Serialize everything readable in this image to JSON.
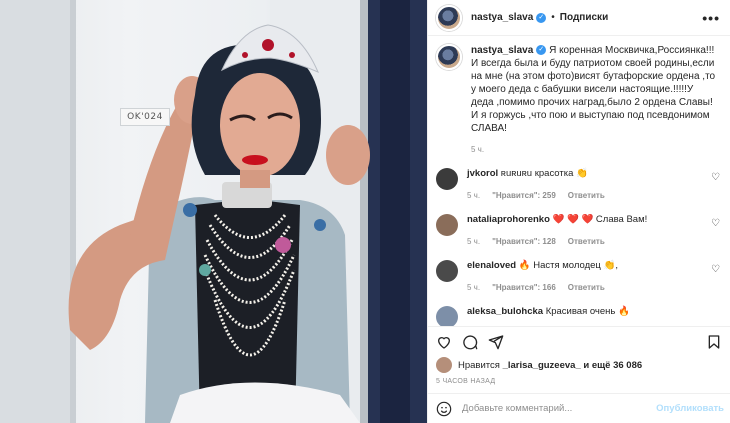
{
  "post": {
    "username": "nastya_slava",
    "follow_label": "Подписки",
    "more_label": "•••",
    "photo_tag_text": "OK'024"
  },
  "caption": {
    "username": "nastya_slava",
    "text": "Я коренная Москвичка,Россиянка!!! И всегда была и буду патриотом своей родины,если на мне (на этом фото)висят бутафорские ордена ,то у моего деда с бабушки висели настоящие.!!!!!У деда ,помимо прочих наград,было 2 ордена Славы! И я горжусь ,что пою и выступаю под псевдонимом СЛАВА!",
    "time": "5 ч."
  },
  "comments": [
    {
      "username": "jvkorol",
      "text": "ʀuʀuʀu красотка 👏",
      "time": "5 ч.",
      "likes": "\"Нравится\": 259",
      "reply": "Ответить",
      "avatar_color": "#3b3b3b"
    },
    {
      "username": "nataliaprohorenko",
      "text": "❤️ ❤️ ❤️ Слава Вам!",
      "time": "5 ч.",
      "likes": "\"Нравится\": 128",
      "reply": "Ответить",
      "avatar_color": "#8a6d5a"
    },
    {
      "username": "elenaloved",
      "text": "🔥 Настя молодец 👏,",
      "time": "5 ч.",
      "likes": "\"Нравится\": 166",
      "reply": "Ответить",
      "avatar_color": "#4a4a4a"
    },
    {
      "username": "aleksa_bulohcka",
      "text": "Красивая очень 🔥",
      "time": "",
      "likes": "",
      "reply": "",
      "avatar_color": "#7d8fa8"
    }
  ],
  "likes_line": {
    "prefix": "Нравится",
    "user": "_larisa_guzeeva_",
    "suffix": "и ещё 36 086"
  },
  "posted_ago": "5 ЧАСОВ НАЗАД",
  "add_comment": {
    "placeholder": "Добавьте комментарий...",
    "publish_label": "Опубликовать"
  },
  "icons": [
    "heart-icon",
    "comment-icon",
    "share-icon",
    "bookmark-icon",
    "emoji-icon",
    "verified-icon"
  ],
  "colors": {
    "verified": "#3897f0",
    "publish_disabled": "#b2dffc",
    "muted": "#8e8e8e"
  }
}
